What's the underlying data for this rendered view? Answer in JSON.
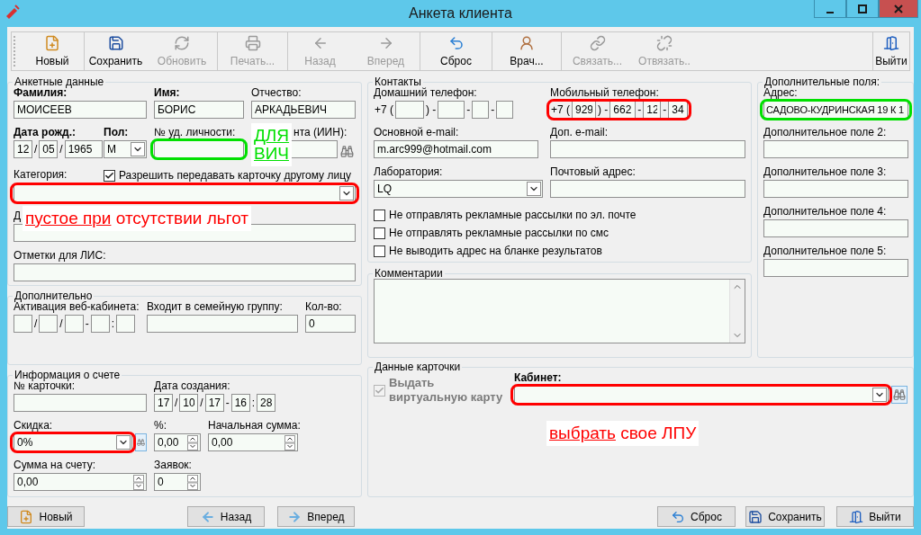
{
  "window": {
    "title": "Анкета клиента"
  },
  "toolbar": [
    {
      "label": "Новый",
      "disabled": false
    },
    {
      "label": "Сохранить",
      "disabled": false
    },
    {
      "label": "Обновить",
      "disabled": true
    },
    {
      "label": "Печать...",
      "disabled": true
    },
    {
      "label": "Назад",
      "disabled": true
    },
    {
      "label": "Вперед",
      "disabled": true
    },
    {
      "label": "Сброс",
      "disabled": false
    },
    {
      "label": "Врач...",
      "disabled": false
    },
    {
      "label": "Связать...",
      "disabled": true
    },
    {
      "label": "Отвязать..",
      "disabled": true
    },
    {
      "label": "Выйти",
      "disabled": false
    }
  ],
  "personal": {
    "title": "Анкетные данные",
    "last_name": {
      "label": "Фамилия:",
      "value": "МОИСЕЕВ",
      "required": true
    },
    "first_name": {
      "label": "Имя:",
      "value": "БОРИС",
      "required": true
    },
    "patronymic": {
      "label": "Отчество:",
      "value": "АРКАДЬЕВИЧ"
    },
    "birth_date": {
      "label": "Дата рожд.:",
      "required": true,
      "segments": [
        {
          "kind": "box",
          "value": "12"
        },
        {
          "kind": "text",
          "text": "/"
        },
        {
          "kind": "box",
          "value": "05"
        },
        {
          "kind": "text",
          "text": "/"
        },
        {
          "kind": "box",
          "value": "1965"
        }
      ]
    },
    "sex": {
      "label": "Пол:",
      "value": "М",
      "required": true
    },
    "id_document": {
      "label": "№ уд. личности:",
      "highlight": {
        "color": "#00e000"
      }
    },
    "inn": {
      "label": "нта (ИИН):"
    },
    "category": {
      "label": "Категория:",
      "highlight": {
        "color": "#ff0000"
      }
    },
    "allow_transfer": {
      "label": "Разрешить передавать карточку другому лицу",
      "checked": true
    },
    "row_4": {
      "label": "Д"
    },
    "lis_notes": {
      "label": "Отметки для ЛИС:"
    }
  },
  "contacts": {
    "title": "Контакты",
    "home_phone": {
      "label": "Домашний телефон:",
      "segments": [
        {
          "kind": "text",
          "text": "+7 ("
        },
        {
          "kind": "box"
        },
        {
          "kind": "text",
          "text": ") -"
        },
        {
          "kind": "box"
        },
        {
          "kind": "text",
          "text": "-"
        },
        {
          "kind": "box"
        },
        {
          "kind": "text",
          "text": "-"
        },
        {
          "kind": "box"
        }
      ]
    },
    "mobile_phone": {
      "label": "Мобильный телефон:",
      "highlight": {
        "color": "#ff0000"
      },
      "segments": [
        {
          "kind": "text",
          "text": "+7 ("
        },
        {
          "kind": "box",
          "value": "929"
        },
        {
          "kind": "text",
          "text": ") -"
        },
        {
          "kind": "box",
          "value": "662"
        },
        {
          "kind": "text",
          "text": "-"
        },
        {
          "kind": "box",
          "value": "12"
        },
        {
          "kind": "text",
          "text": "-"
        },
        {
          "kind": "box",
          "value": "34"
        }
      ]
    },
    "email": {
      "label": "Основной e-mail:",
      "value": "m.arc999@hotmail.com"
    },
    "extra_email": {
      "label": "Доп. e-mail:"
    },
    "laboratory": {
      "label": "Лаборатория:",
      "value": "LQ"
    },
    "postal_address": {
      "label": "Почтовый адрес:"
    },
    "options": [
      {
        "label": "Не отправлять рекламные рассылки по эл. почте",
        "checked": false
      },
      {
        "label": "Не отправлять рекламные рассылки по смс",
        "checked": false
      },
      {
        "label": "Не выводить адрес на бланке результатов",
        "checked": false
      }
    ]
  },
  "extra_fields": {
    "title": "Дополнительные поля:",
    "fields": [
      {
        "label": "Адрес:",
        "value": "САДОВО-КУДРИНСКАЯ 19 К 1",
        "highlight": {
          "color": "#00e000"
        }
      },
      {
        "label": "Дополнительное поле 2:"
      },
      {
        "label": "Дополнительное поле 3:"
      },
      {
        "label": "Дополнительное поле 4:"
      },
      {
        "label": "Дополнительное поле 5:"
      }
    ]
  },
  "additional": {
    "title": "Дополнительно",
    "activation": {
      "label": "Активация веб-кабинета:",
      "segments": [
        {
          "kind": "box"
        },
        {
          "kind": "text",
          "text": "/"
        },
        {
          "kind": "box"
        },
        {
          "kind": "text",
          "text": "/"
        },
        {
          "kind": "box"
        },
        {
          "kind": "text",
          "text": "-"
        },
        {
          "kind": "box"
        },
        {
          "kind": "text",
          "text": ":"
        },
        {
          "kind": "box"
        }
      ]
    },
    "family_group": {
      "label": "Входит в семейную группу:"
    },
    "count": {
      "label": "Кол-во:",
      "value": "0"
    }
  },
  "comments": {
    "title": "Комментарии"
  },
  "account": {
    "title": "Информация о счете",
    "card_number": {
      "label": "№ карточки:"
    },
    "created": {
      "label": "Дата создания:",
      "segments": [
        {
          "kind": "box",
          "value": "17"
        },
        {
          "kind": "text",
          "text": "/"
        },
        {
          "kind": "box",
          "value": "10"
        },
        {
          "kind": "text",
          "text": "/"
        },
        {
          "kind": "box",
          "value": "17"
        },
        {
          "kind": "text",
          "text": "-"
        },
        {
          "kind": "box",
          "value": "16"
        },
        {
          "kind": "text",
          "text": ":"
        },
        {
          "kind": "box",
          "value": "28"
        }
      ]
    },
    "discount": {
      "label": "Скидка:",
      "value": "0%",
      "highlight": {
        "color": "#ff0000"
      }
    },
    "percent": {
      "label": "%:",
      "value": "0,00"
    },
    "initial_sum": {
      "label": "Начальная сумма:",
      "value": "0,00"
    },
    "balance": {
      "label": "Сумма на счету:",
      "value": "0,00"
    },
    "orders": {
      "label": "Заявок:",
      "value": "0"
    }
  },
  "card_data": {
    "title": "Данные карточки",
    "virtual_card": {
      "label": "Выдать виртуальную карту",
      "checked": true,
      "disabled": true
    },
    "cabinet": {
      "label": "Кабинет:",
      "required": true,
      "highlight": {
        "color": "#ff0000"
      }
    }
  },
  "footer": [
    {
      "label": "Новый"
    },
    {
      "label": "Назад"
    },
    {
      "label": "Вперед"
    },
    {
      "label": "Сброс"
    },
    {
      "label": "Сохранить"
    },
    {
      "label": "Выйти"
    }
  ],
  "notes": [
    {
      "color": "#00e000",
      "parts": [
        {
          "text": "ДЛЯ ВИЧ",
          "underline": true
        }
      ]
    },
    {
      "color": "#ff0000",
      "parts": [
        {
          "text": "пустое при",
          "underline": true
        },
        {
          "text": " отсутствии льгот",
          "underline": false
        }
      ]
    },
    {
      "color": "#ff0000",
      "parts": [
        {
          "text": "выбрать",
          "underline": true
        },
        {
          "text": " свое ЛПУ",
          "underline": false
        }
      ]
    }
  ]
}
